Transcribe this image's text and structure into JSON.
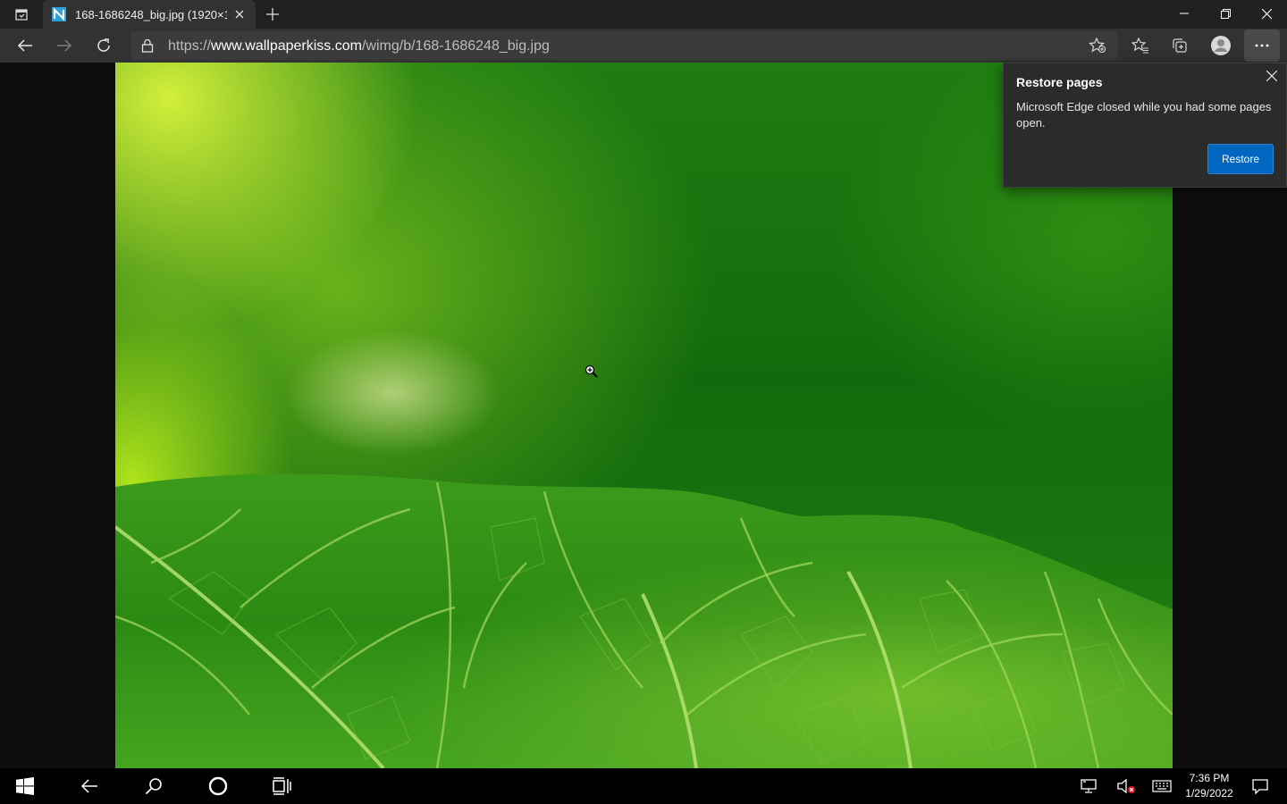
{
  "browser": {
    "tab": {
      "title": "168-1686248_big.jpg (1920×1280)",
      "icon": "site-favicon"
    },
    "address": {
      "scheme": "https://",
      "host": "www.wallpaperkiss.com",
      "path": "/wimg/b/168-1686248_big.jpg"
    },
    "icons": [
      "tab-actions-icon",
      "close-icon",
      "plus-icon",
      "minimize-icon",
      "restore-window-icon",
      "close-window-icon",
      "back-arrow-icon",
      "forward-arrow-icon",
      "refresh-icon",
      "lock-icon",
      "star-add-icon",
      "favorites-icon",
      "collections-icon",
      "profile-icon",
      "more-icon"
    ]
  },
  "popup": {
    "title": "Restore pages",
    "message": "Microsoft Edge closed while you had some pages open.",
    "button": "Restore"
  },
  "taskbar": {
    "time": "7:36 PM",
    "date": "1/29/2022",
    "icons": [
      "windows-start-icon",
      "back-arrow-icon",
      "search-icon",
      "cortana-icon",
      "task-view-icon",
      "network-icon",
      "volume-muted-icon",
      "keyboard-icon",
      "notification-icon"
    ]
  },
  "colors": {
    "titlebar": "#202020",
    "toolbar": "#323232",
    "accent": "#0067c0",
    "leaf_green": "#2f8f17"
  }
}
